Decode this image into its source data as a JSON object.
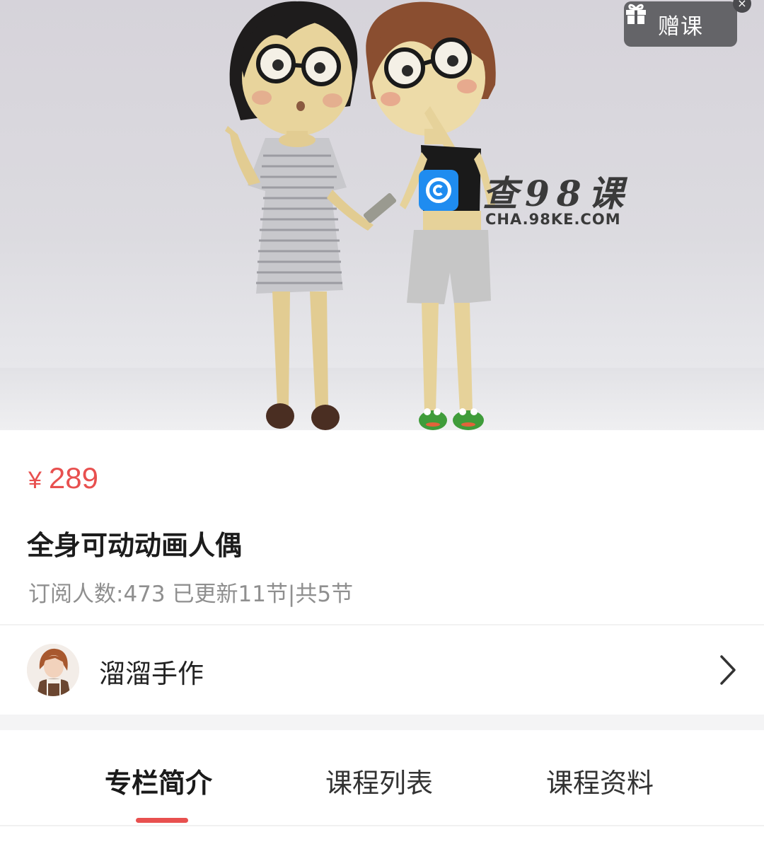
{
  "hero": {
    "gift_button_label": "赠课",
    "close_glyph": "×",
    "watermark_title": "查98课",
    "watermark_domain": "CHA.98KE.COM"
  },
  "course": {
    "price_symbol": "¥",
    "price": "289",
    "title": "全身可动动画人偶",
    "meta": "订阅人数:473 已更新11节|共5节"
  },
  "author": {
    "name": "溜溜手作"
  },
  "tabs": [
    {
      "label": "专栏简介",
      "active": true
    },
    {
      "label": "课程列表",
      "active": false
    },
    {
      "label": "课程资料",
      "active": false
    }
  ],
  "colors": {
    "accent": "#e8504f",
    "watermark_blue": "#1f8cf0"
  },
  "icons": [
    "gift-icon",
    "close-icon",
    "chevron-right-icon",
    "watermark-logo-icon"
  ]
}
